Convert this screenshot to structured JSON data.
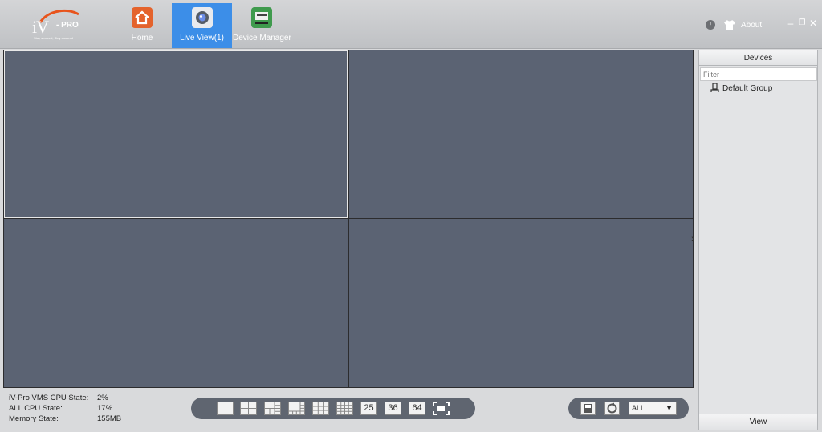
{
  "app": {
    "logo_text": "iV",
    "logo_pro": "- PRO",
    "logo_tagline": "Stay secured, Stay assured"
  },
  "nav": {
    "tabs": [
      {
        "label": "Home",
        "icon": "home-icon"
      },
      {
        "label": "Live View(1)",
        "icon": "camera-icon",
        "active": true
      },
      {
        "label": "Device Manager",
        "icon": "device-manager-icon"
      }
    ]
  },
  "header_right": {
    "info_glyph": "!",
    "about_label": "About"
  },
  "window": {
    "minimize": "–",
    "restore": "❐",
    "close": "✕"
  },
  "devices": {
    "title": "Devices",
    "filter_placeholder": "Filter",
    "tree": [
      {
        "label": "Default Group",
        "icon": "group-icon"
      }
    ],
    "footer": "View"
  },
  "status": {
    "rows": [
      {
        "label": "iV-Pro VMS CPU State:",
        "value": "2%"
      },
      {
        "label": "ALL CPU State:",
        "value": "17%"
      },
      {
        "label": "Memory State:",
        "value": "155MB"
      }
    ]
  },
  "layouts": {
    "split_25": "25",
    "split_36": "36",
    "split_64": "64"
  },
  "controls": {
    "stream_select": "ALL",
    "select_arrow": "▼"
  },
  "colors": {
    "active_tab": "#3c8ee8",
    "video_cell": "#5b6373",
    "bar": "#5f6570"
  }
}
